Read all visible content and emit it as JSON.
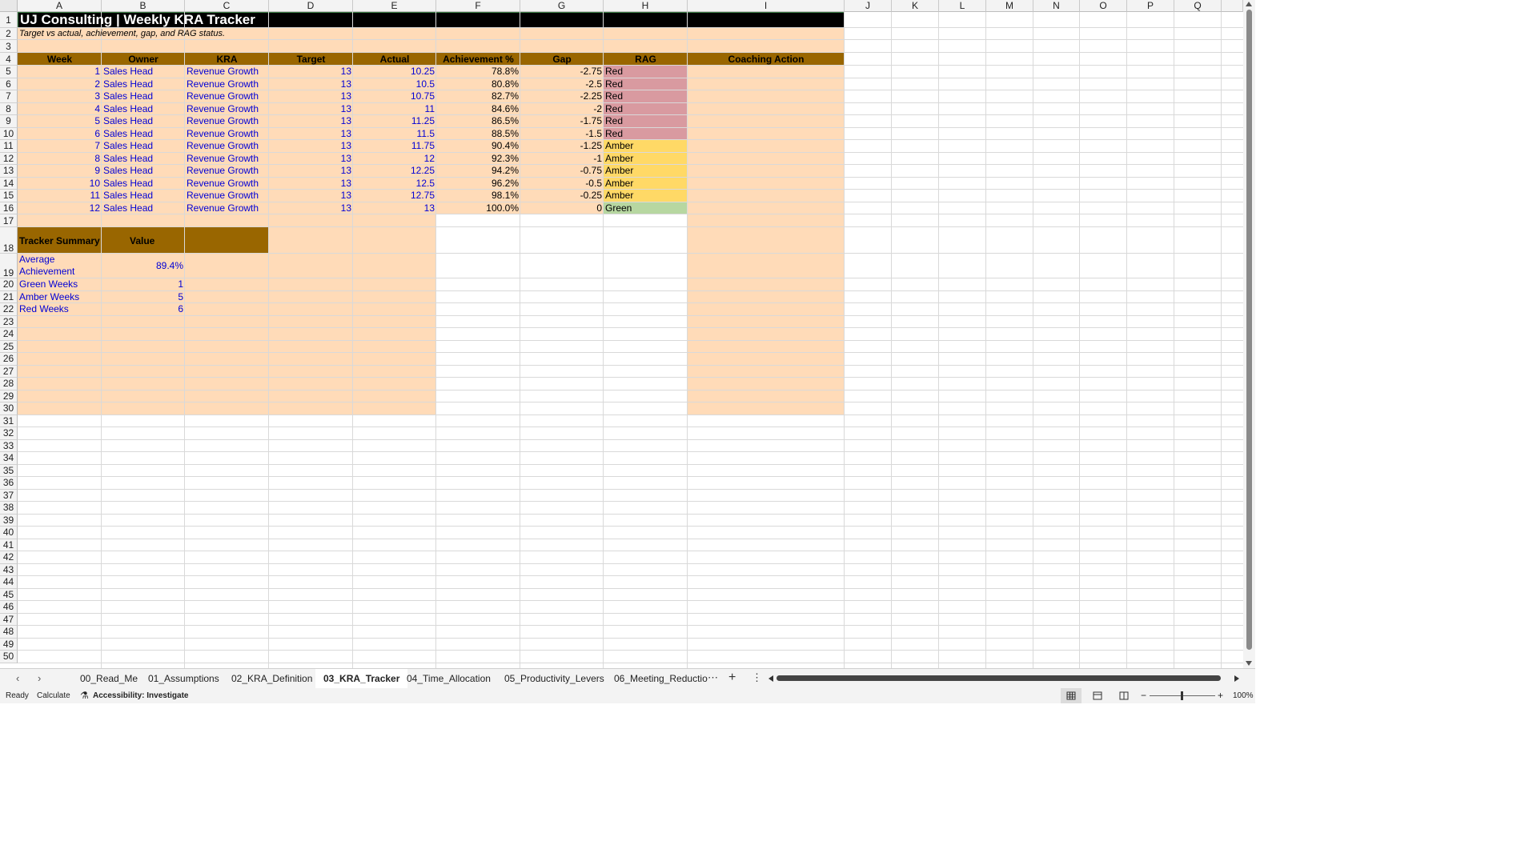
{
  "columns": [
    "A",
    "B",
    "C",
    "D",
    "E",
    "F",
    "G",
    "H",
    "I",
    "J",
    "K",
    "L",
    "M",
    "N",
    "O",
    "P",
    "Q"
  ],
  "rows_visible": [
    1,
    2,
    3,
    4,
    5,
    6,
    7,
    8,
    9,
    10,
    11,
    12,
    13,
    14,
    15,
    16,
    17,
    18,
    19,
    20,
    21,
    22,
    23,
    24,
    25,
    26,
    27,
    28,
    29,
    30,
    31,
    32,
    33,
    34,
    35,
    36,
    37,
    38,
    39,
    40,
    41,
    42,
    43,
    44,
    45,
    46,
    47,
    48,
    49,
    50
  ],
  "sheet": {
    "title": "UJ Consulting | Weekly KRA Tracker",
    "subtitle": "Target vs actual, achievement, gap, and RAG status.",
    "headers": [
      "Week",
      "Owner",
      "KRA",
      "Target",
      "Actual",
      "Achievement %",
      "Gap",
      "RAG",
      "Coaching Action"
    ],
    "rows": [
      {
        "week": "1",
        "owner": "Sales Head",
        "kra": "Revenue Growth",
        "target": "13",
        "actual": "10.25",
        "ach": "78.8%",
        "gap": "-2.75",
        "rag": "Red"
      },
      {
        "week": "2",
        "owner": "Sales Head",
        "kra": "Revenue Growth",
        "target": "13",
        "actual": "10.5",
        "ach": "80.8%",
        "gap": "-2.5",
        "rag": "Red"
      },
      {
        "week": "3",
        "owner": "Sales Head",
        "kra": "Revenue Growth",
        "target": "13",
        "actual": "10.75",
        "ach": "82.7%",
        "gap": "-2.25",
        "rag": "Red"
      },
      {
        "week": "4",
        "owner": "Sales Head",
        "kra": "Revenue Growth",
        "target": "13",
        "actual": "11",
        "ach": "84.6%",
        "gap": "-2",
        "rag": "Red"
      },
      {
        "week": "5",
        "owner": "Sales Head",
        "kra": "Revenue Growth",
        "target": "13",
        "actual": "11.25",
        "ach": "86.5%",
        "gap": "-1.75",
        "rag": "Red"
      },
      {
        "week": "6",
        "owner": "Sales Head",
        "kra": "Revenue Growth",
        "target": "13",
        "actual": "11.5",
        "ach": "88.5%",
        "gap": "-1.5",
        "rag": "Red"
      },
      {
        "week": "7",
        "owner": "Sales Head",
        "kra": "Revenue Growth",
        "target": "13",
        "actual": "11.75",
        "ach": "90.4%",
        "gap": "-1.25",
        "rag": "Amber"
      },
      {
        "week": "8",
        "owner": "Sales Head",
        "kra": "Revenue Growth",
        "target": "13",
        "actual": "12",
        "ach": "92.3%",
        "gap": "-1",
        "rag": "Amber"
      },
      {
        "week": "9",
        "owner": "Sales Head",
        "kra": "Revenue Growth",
        "target": "13",
        "actual": "12.25",
        "ach": "94.2%",
        "gap": "-0.75",
        "rag": "Amber"
      },
      {
        "week": "10",
        "owner": "Sales Head",
        "kra": "Revenue Growth",
        "target": "13",
        "actual": "12.5",
        "ach": "96.2%",
        "gap": "-0.5",
        "rag": "Amber"
      },
      {
        "week": "11",
        "owner": "Sales Head",
        "kra": "Revenue Growth",
        "target": "13",
        "actual": "12.75",
        "ach": "98.1%",
        "gap": "-0.25",
        "rag": "Amber"
      },
      {
        "week": "12",
        "owner": "Sales Head",
        "kra": "Revenue Growth",
        "target": "13",
        "actual": "13",
        "ach": "100.0%",
        "gap": "0",
        "rag": "Green"
      }
    ],
    "summary": {
      "header_label": "Tracker Summary",
      "header_value": "Value",
      "items": [
        {
          "label": "Average Achievement",
          "value": "89.4%"
        },
        {
          "label": "Green Weeks",
          "value": "1"
        },
        {
          "label": "Amber Weeks",
          "value": "5"
        },
        {
          "label": "Red Weeks",
          "value": "6"
        }
      ]
    }
  },
  "colors": {
    "title_bg": "#000000",
    "peach": "#ffdbb8",
    "header_bg": "#996600",
    "red": "#d99aa0",
    "amber": "#ffd966",
    "green": "#b7d7a1",
    "input_text": "#0000d6"
  },
  "tabs": [
    {
      "label": "00_Read_Me",
      "active": false
    },
    {
      "label": "01_Assumptions",
      "active": false
    },
    {
      "label": "02_KRA_Definition",
      "active": false
    },
    {
      "label": "03_KRA_Tracker",
      "active": true
    },
    {
      "label": "04_Time_Allocation",
      "active": false
    },
    {
      "label": "05_Productivity_Levers",
      "active": false
    },
    {
      "label": "06_Meeting_Reductio",
      "active": false
    }
  ],
  "tab_icons": {
    "prev": "chevron-left-icon",
    "next": "chevron-right-icon",
    "more": "ellipsis-icon",
    "add": "plus-icon",
    "menu": "vertical-dots-icon"
  },
  "status": {
    "ready": "Ready",
    "calculate": "Calculate",
    "accessibility": "Accessibility: Investigate",
    "zoom": "100%"
  }
}
